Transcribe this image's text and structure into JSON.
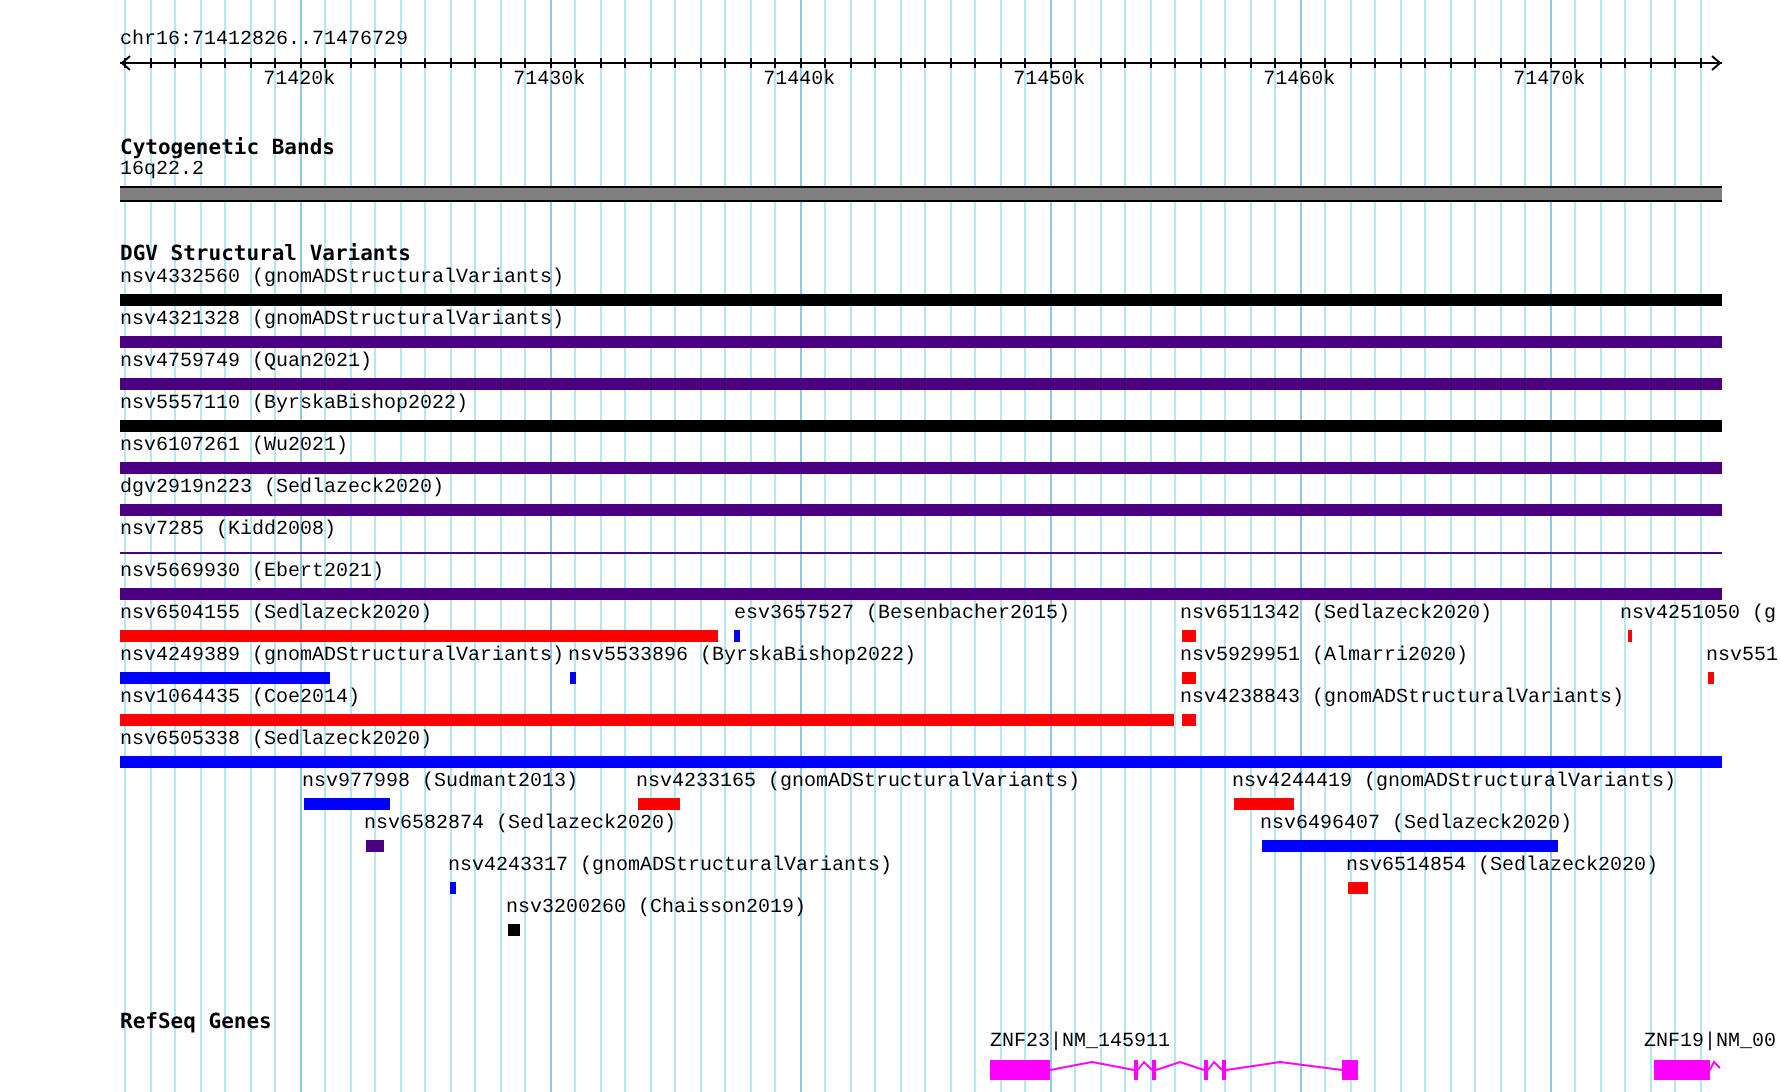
{
  "ruler": {
    "location": "chr16:71412826..71476729",
    "tick_labels": [
      "71420k",
      "71430k",
      "71440k",
      "71450k",
      "71460k",
      "71470k"
    ]
  },
  "tracks": [
    {
      "kind": "cytoband",
      "title": "Cytogenetic Bands",
      "band": "16q22.2"
    },
    {
      "kind": "variants",
      "title": "DGV Structural Variants",
      "features": [
        {
          "label": "nsv4332560 (gnomADStructuralVariants)",
          "color": "#000000"
        },
        {
          "label": "nsv4321328 (gnomADStructuralVariants)",
          "color": "#4b0082"
        },
        {
          "label": "nsv4759749 (Quan2021)",
          "color": "#4b0082"
        },
        {
          "label": "nsv5557110 (ByrskaBishop2022)",
          "color": "#000000"
        },
        {
          "label": "nsv6107261 (Wu2021)",
          "color": "#4b0082"
        },
        {
          "label": "dgv2919n223 (Sedlazeck2020)",
          "color": "#4b0082"
        },
        {
          "label": "nsv7285 (Kidd2008)",
          "color": "#4b0082"
        },
        {
          "label": "nsv5669930 (Ebert2021)",
          "color": "#4b0082"
        },
        {
          "label": "nsv6504155 (Sedlazeck2020)",
          "color": "#ff0000"
        },
        {
          "label": "esv3657527 (Besenbacher2015)",
          "color": "#0000ff"
        },
        {
          "label": "nsv6511342 (Sedlazeck2020)",
          "color": "#ff0000"
        },
        {
          "label": "nsv4251050 (g",
          "color": "#ff0000"
        },
        {
          "label": "nsv4249389 (gnomADStructuralVariants)",
          "color": "#0000ff"
        },
        {
          "label": "nsv5533896 (ByrskaBishop2022)",
          "color": "#0000ff"
        },
        {
          "label": "nsv5929951 (Almarri2020)",
          "color": "#ff0000"
        },
        {
          "label": "nsv551",
          "color": "#ff0000"
        },
        {
          "label": "nsv1064435 (Coe2014)",
          "color": "#ff0000"
        },
        {
          "label": "nsv4238843 (gnomADStructuralVariants)",
          "color": "#ff0000"
        },
        {
          "label": "nsv6505338 (Sedlazeck2020)",
          "color": "#0000ff"
        },
        {
          "label": "nsv977998 (Sudmant2013)",
          "color": "#0000ff"
        },
        {
          "label": "nsv4233165 (gnomADStructuralVariants)",
          "color": "#ff0000"
        },
        {
          "label": "nsv4244419 (gnomADStructuralVariants)",
          "color": "#ff0000"
        },
        {
          "label": "nsv6582874 (Sedlazeck2020)",
          "color": "#4b0082"
        },
        {
          "label": "nsv6496407 (Sedlazeck2020)",
          "color": "#0000ff"
        },
        {
          "label": "nsv4243317 (gnomADStructuralVariants)",
          "color": "#0000ff"
        },
        {
          "label": "nsv6514854 (Sedlazeck2020)",
          "color": "#ff0000"
        },
        {
          "label": "nsv3200260 (Chaisson2019)",
          "color": "#000000"
        }
      ]
    },
    {
      "kind": "genes",
      "title": "RefSeq Genes",
      "features": [
        {
          "label": "ZNF23|NM_145911"
        },
        {
          "label": "ZNF19|NM_00"
        }
      ]
    }
  ]
}
